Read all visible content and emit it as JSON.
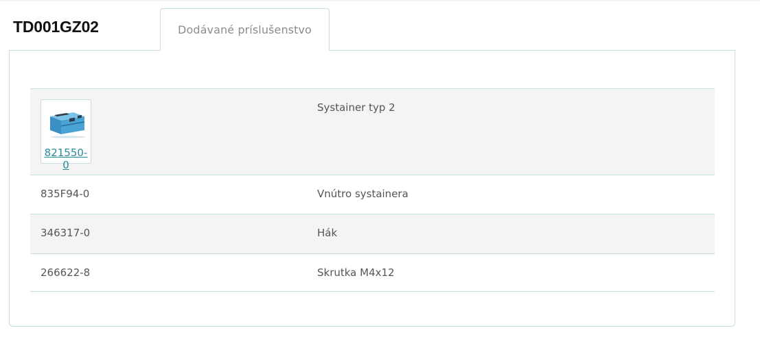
{
  "product": {
    "code": "TD001GZ02"
  },
  "tabs": [
    {
      "label": "Dodávané príslušenstvo",
      "active": true
    }
  ],
  "accessories": {
    "rows": [
      {
        "code": "821550-0",
        "description": "Systainer typ 2",
        "has_image": true,
        "image_icon": "systainer-case-icon",
        "shaded": true
      },
      {
        "code": "835F94-0",
        "description": "Vnútro systainera",
        "has_image": false,
        "shaded": false
      },
      {
        "code": "346317-0",
        "description": "Hák",
        "has_image": false,
        "shaded": true
      },
      {
        "code": "266622-8",
        "description": "Skrutka M4x12",
        "has_image": false,
        "shaded": false
      }
    ]
  },
  "colors": {
    "border": "#c6dde2",
    "shaded_row": "#f4f4f4",
    "link": "#2a8a9c",
    "text": "#555555",
    "tab_label": "#8c8c8c",
    "case_blue": "#4aa3d6"
  }
}
